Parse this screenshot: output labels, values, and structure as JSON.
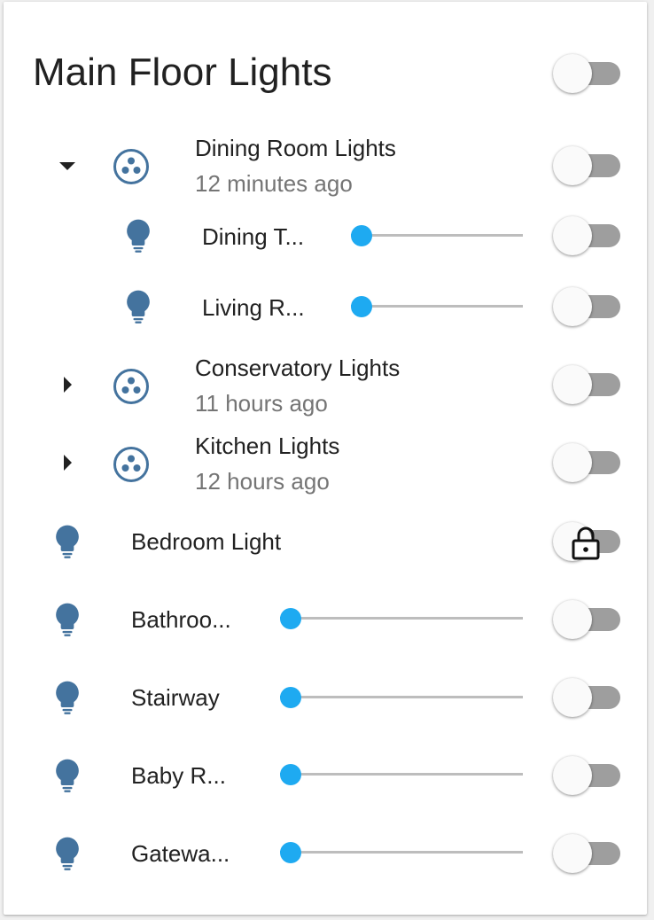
{
  "card": {
    "title": "Main Floor Lights",
    "main_toggle_on": false
  },
  "colors": {
    "icon": "#44739e",
    "slider": "#1eaaf1",
    "track": "#bdbdbd",
    "toggle_track": "#9e9e9e"
  },
  "groups": [
    {
      "name": "Dining Room Lights",
      "last_changed": "12 minutes ago",
      "expanded": true,
      "icon": "group-icon",
      "toggle_on": false,
      "children": [
        {
          "name": "Dining T...",
          "icon": "lightbulb-icon",
          "brightness": 0,
          "toggle_on": false
        },
        {
          "name": "Living R...",
          "icon": "lightbulb-icon",
          "brightness": 0,
          "toggle_on": false
        }
      ]
    },
    {
      "name": "Conservatory Lights",
      "last_changed": "11 hours ago",
      "expanded": false,
      "icon": "group-icon",
      "toggle_on": false
    },
    {
      "name": "Kitchen Lights",
      "last_changed": "12 hours ago",
      "expanded": false,
      "icon": "group-icon",
      "toggle_on": false
    }
  ],
  "lights": [
    {
      "name": "Bedroom Light",
      "icon": "lightbulb-icon",
      "locked": true,
      "toggle_on": false
    },
    {
      "name": "Bathroo...",
      "icon": "lightbulb-icon",
      "brightness": 0,
      "toggle_on": false
    },
    {
      "name": "Stairway",
      "icon": "lightbulb-icon",
      "brightness": 0,
      "toggle_on": false
    },
    {
      "name": "Baby R...",
      "icon": "lightbulb-icon",
      "brightness": 0,
      "toggle_on": false
    },
    {
      "name": "Gatewa...",
      "icon": "lightbulb-icon",
      "brightness": 0,
      "toggle_on": false
    }
  ]
}
